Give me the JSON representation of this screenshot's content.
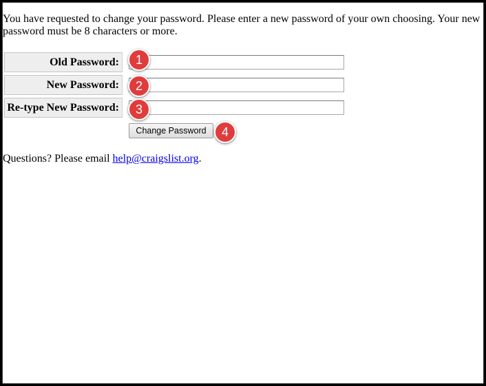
{
  "intro_text": "You have requested to change your password. Please enter a new password of your own choosing. Your new password must be 8 characters or more.",
  "form": {
    "old_password": {
      "label": "Old Password:",
      "value": "",
      "marker": "1"
    },
    "new_password": {
      "label": "New Password:",
      "value": "",
      "marker": "2"
    },
    "retype_password": {
      "label": "Re-type New Password:",
      "value": "",
      "marker": "3"
    },
    "submit": {
      "label": "Change Password",
      "marker": "4"
    }
  },
  "footer": {
    "prefix": "Questions? Please email ",
    "email": "help@craigslist.org",
    "suffix": "."
  },
  "colors": {
    "marker": "#e03c3c",
    "link": "#0000ee",
    "label_background": "#eeeeee"
  }
}
